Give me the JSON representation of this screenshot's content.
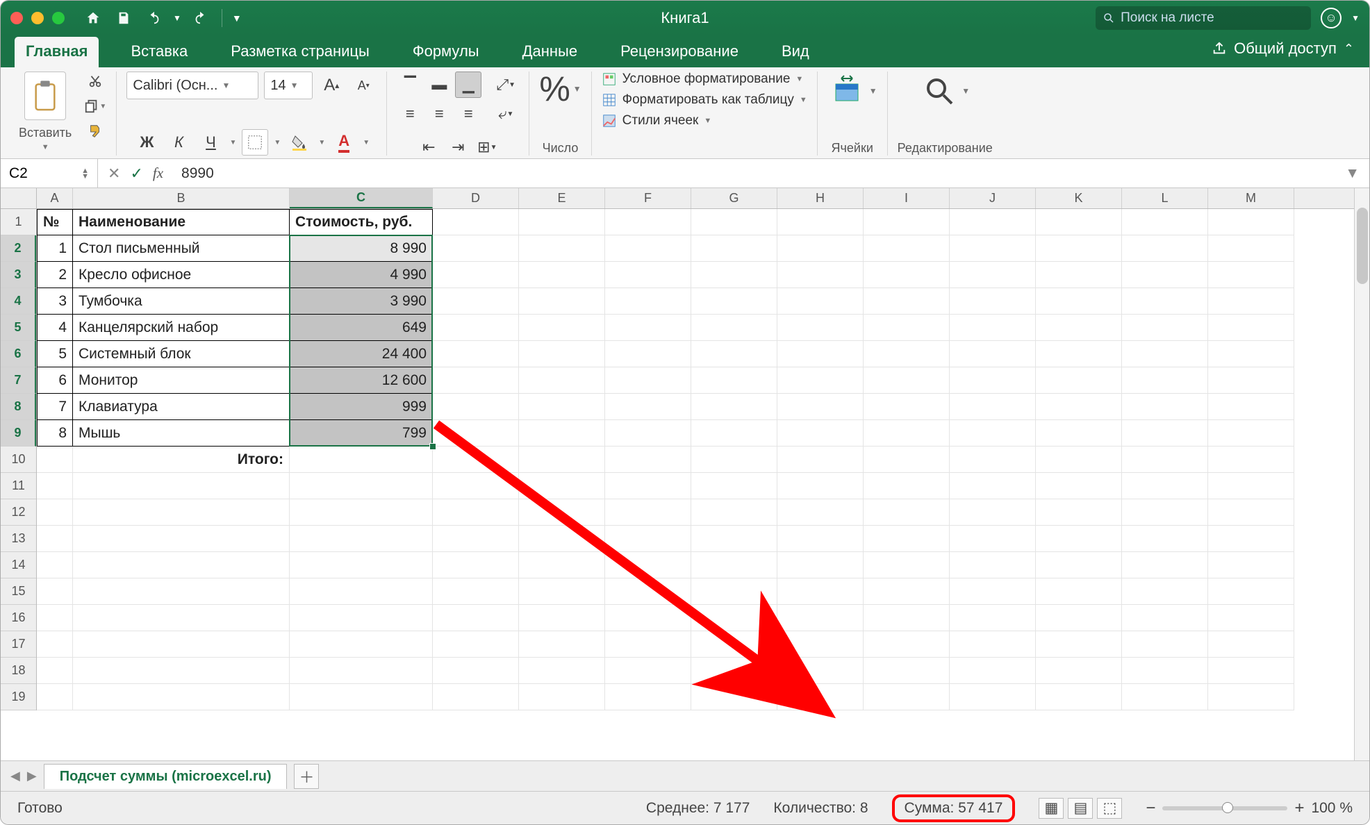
{
  "title": "Книга1",
  "search_placeholder": "Поиск на листе",
  "tabs": [
    "Главная",
    "Вставка",
    "Разметка страницы",
    "Формулы",
    "Данные",
    "Рецензирование",
    "Вид"
  ],
  "share": "Общий доступ",
  "ribbon": {
    "paste": "Вставить",
    "font_name": "Calibri (Осн...",
    "font_size": "14",
    "number": "Число",
    "cond_fmt": "Условное форматирование",
    "as_table": "Форматировать как таблицу",
    "cell_styles": "Стили ячеек",
    "cells": "Ячейки",
    "editing": "Редактирование"
  },
  "formula": {
    "name": "C2",
    "value": "8990"
  },
  "col_letters": [
    "A",
    "B",
    "C",
    "D",
    "E",
    "F",
    "G",
    "H",
    "I",
    "J",
    "K",
    "L",
    "M"
  ],
  "row_nums": [
    "1",
    "2",
    "3",
    "4",
    "5",
    "6",
    "7",
    "8",
    "9",
    "10",
    "11",
    "12",
    "13",
    "14",
    "15",
    "16",
    "17",
    "18",
    "19"
  ],
  "headers": {
    "a": "№",
    "b": "Наименование",
    "c": "Стоимость, руб."
  },
  "data_rows": [
    {
      "n": "1",
      "name": "Стол письменный",
      "price": "8 990"
    },
    {
      "n": "2",
      "name": "Кресло офисное",
      "price": "4 990"
    },
    {
      "n": "3",
      "name": "Тумбочка",
      "price": "3 990"
    },
    {
      "n": "4",
      "name": "Канцелярский набор",
      "price": "649"
    },
    {
      "n": "5",
      "name": "Системный блок",
      "price": "24 400"
    },
    {
      "n": "6",
      "name": "Монитор",
      "price": "12 600"
    },
    {
      "n": "7",
      "name": "Клавиатура",
      "price": "999"
    },
    {
      "n": "8",
      "name": "Мышь",
      "price": "799"
    }
  ],
  "total_label": "Итого:",
  "sheet_name": "Подсчет суммы (microexcel.ru)",
  "status": {
    "ready": "Готово",
    "avg": "Среднее: 7 177",
    "count": "Количество: 8",
    "sum": "Сумма: 57 417",
    "zoom": "100 %"
  }
}
